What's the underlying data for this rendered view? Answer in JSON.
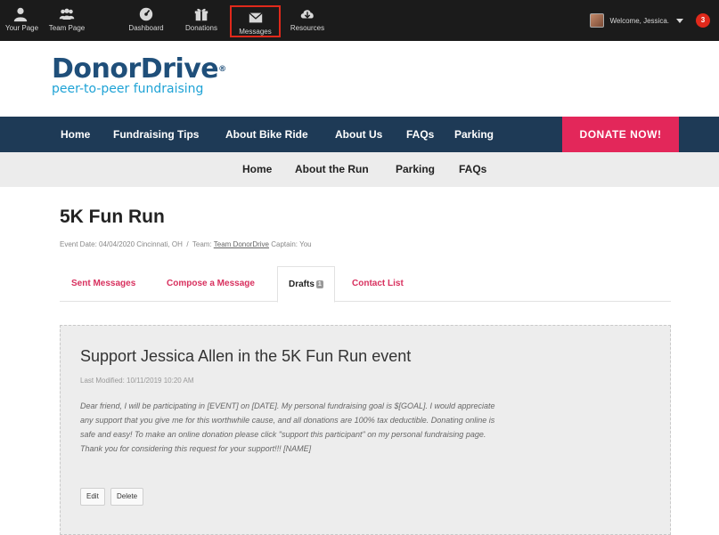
{
  "topbar": {
    "items": [
      {
        "label": "Your Page",
        "icon": "person-icon"
      },
      {
        "label": "Team Page",
        "icon": "team-icon"
      },
      {
        "label": "Dashboard",
        "icon": "dashboard-icon"
      },
      {
        "label": "Donations",
        "icon": "gift-icon"
      },
      {
        "label": "Messages",
        "icon": "envelope-icon"
      },
      {
        "label": "Resources",
        "icon": "cloud-download-icon"
      }
    ],
    "active_item": "Messages",
    "welcome_text": "Welcome, Jessica.",
    "notification_count": "3"
  },
  "logo": {
    "main": "DonorDrive",
    "registered": "®",
    "tagline": "peer-to-peer fundraising"
  },
  "main_nav": {
    "items": [
      "Home",
      "Fundraising Tips",
      "About Bike Ride",
      "About Us",
      "FAQs",
      "Parking"
    ],
    "donate_label": "DONATE NOW!"
  },
  "sub_nav": {
    "items": [
      "Home",
      "About the Run",
      "Parking",
      "FAQs"
    ]
  },
  "event": {
    "title": "5K Fun Run",
    "date_text": "Event Date: 04/04/2020",
    "location": "Cincinnati, OH",
    "separator": "/",
    "team_label": "Team:",
    "team_name": "Team DonorDrive",
    "captain_text": "Captain: You"
  },
  "tabs": {
    "items": [
      "Sent Messages",
      "Compose a Message",
      "Drafts",
      "Contact List"
    ],
    "active": "Drafts",
    "drafts_badge": "1"
  },
  "draft": {
    "title": "Support Jessica Allen in the 5K Fun Run event",
    "last_modified": "Last Modified: 10/11/2019 10:20 AM",
    "body": "Dear friend, I will be participating in [EVENT] on [DATE]. My personal fundraising goal is $[GOAL]. I would appreciate any support that you give me for this worthwhile cause, and all donations are 100% tax deductible. Donating online is safe and easy! To make an online donation please click \"support this participant\" on my personal fundraising page. Thank you for considering this request for your support!!! [NAME]",
    "edit_label": "Edit",
    "delete_label": "Delete"
  },
  "colors": {
    "topbar_bg": "#1b1b1b",
    "nav_bg": "#1e3a56",
    "donate_bg": "#e3275a",
    "subnav_bg": "#ececec",
    "tab_link": "#d8305e",
    "highlight_border": "#e0291b",
    "logo_dark": "#1f4f7a",
    "logo_light": "#1fa3d6"
  }
}
